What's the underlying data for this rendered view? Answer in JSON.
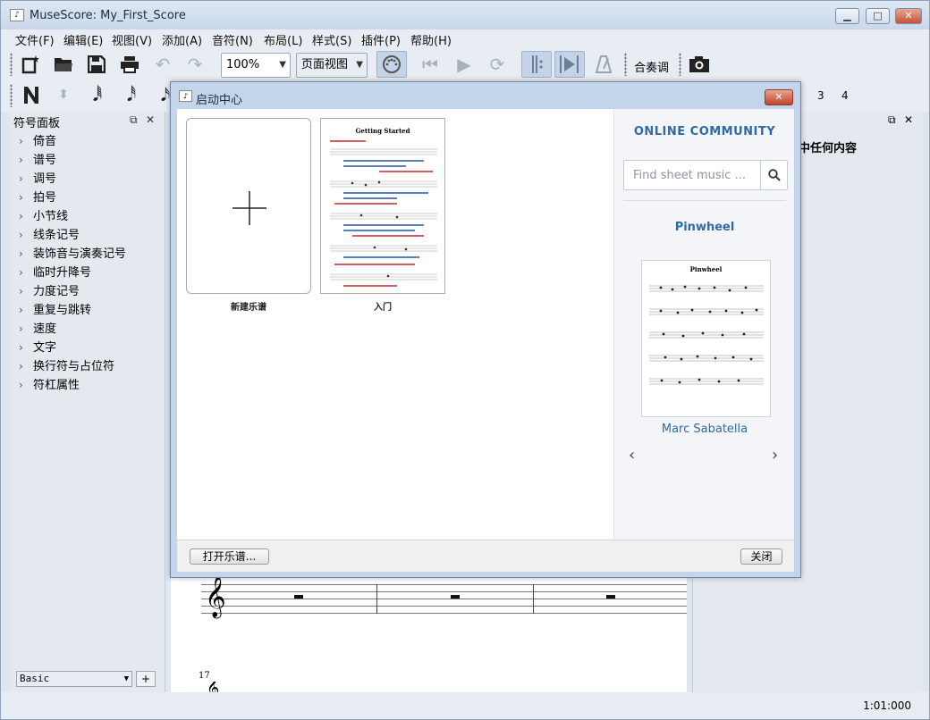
{
  "window": {
    "title": "MuseScore: My_First_Score",
    "app_icon": "♪̃"
  },
  "menus": [
    "文件(F)",
    "编辑(E)",
    "视图(V)",
    "添加(A)",
    "音符(N)",
    "布局(L)",
    "样式(S)",
    "插件(P)",
    "帮助(H)"
  ],
  "toolbar": {
    "zoom": "100%",
    "view_mode": "页面视图",
    "concert_pitch": "合奏调"
  },
  "note_toolbar": {
    "voice_numbers": [
      "3",
      "4"
    ]
  },
  "palette": {
    "title": "符号面板",
    "items": [
      "倚音",
      "谱号",
      "调号",
      "拍号",
      "小节线",
      "线条记号",
      "装饰音与演奏记号",
      "临时升降号",
      "力度记号",
      "重复与跳转",
      "速度",
      "文字",
      "换行符与占位符",
      "符杠属性"
    ],
    "workspace": "Basic",
    "add_label": "+"
  },
  "right_panel": {
    "text": "中任何内容"
  },
  "score": {
    "measure_number": "17"
  },
  "status": {
    "time": "1:01:000"
  },
  "dialog": {
    "title": "启动中心",
    "cards": [
      {
        "label": "新建乐谱"
      },
      {
        "label": "入门",
        "doc_title": "Getting Started"
      }
    ],
    "community": {
      "title": "ONLINE COMMUNITY",
      "search_placeholder": "Find sheet music ...",
      "featured_title": "Pinwheel",
      "featured_composer": "Marc Sabatella",
      "thumb_title": "Pinwheel"
    },
    "open_button": "打开乐谱...",
    "close_button": "关闭"
  }
}
